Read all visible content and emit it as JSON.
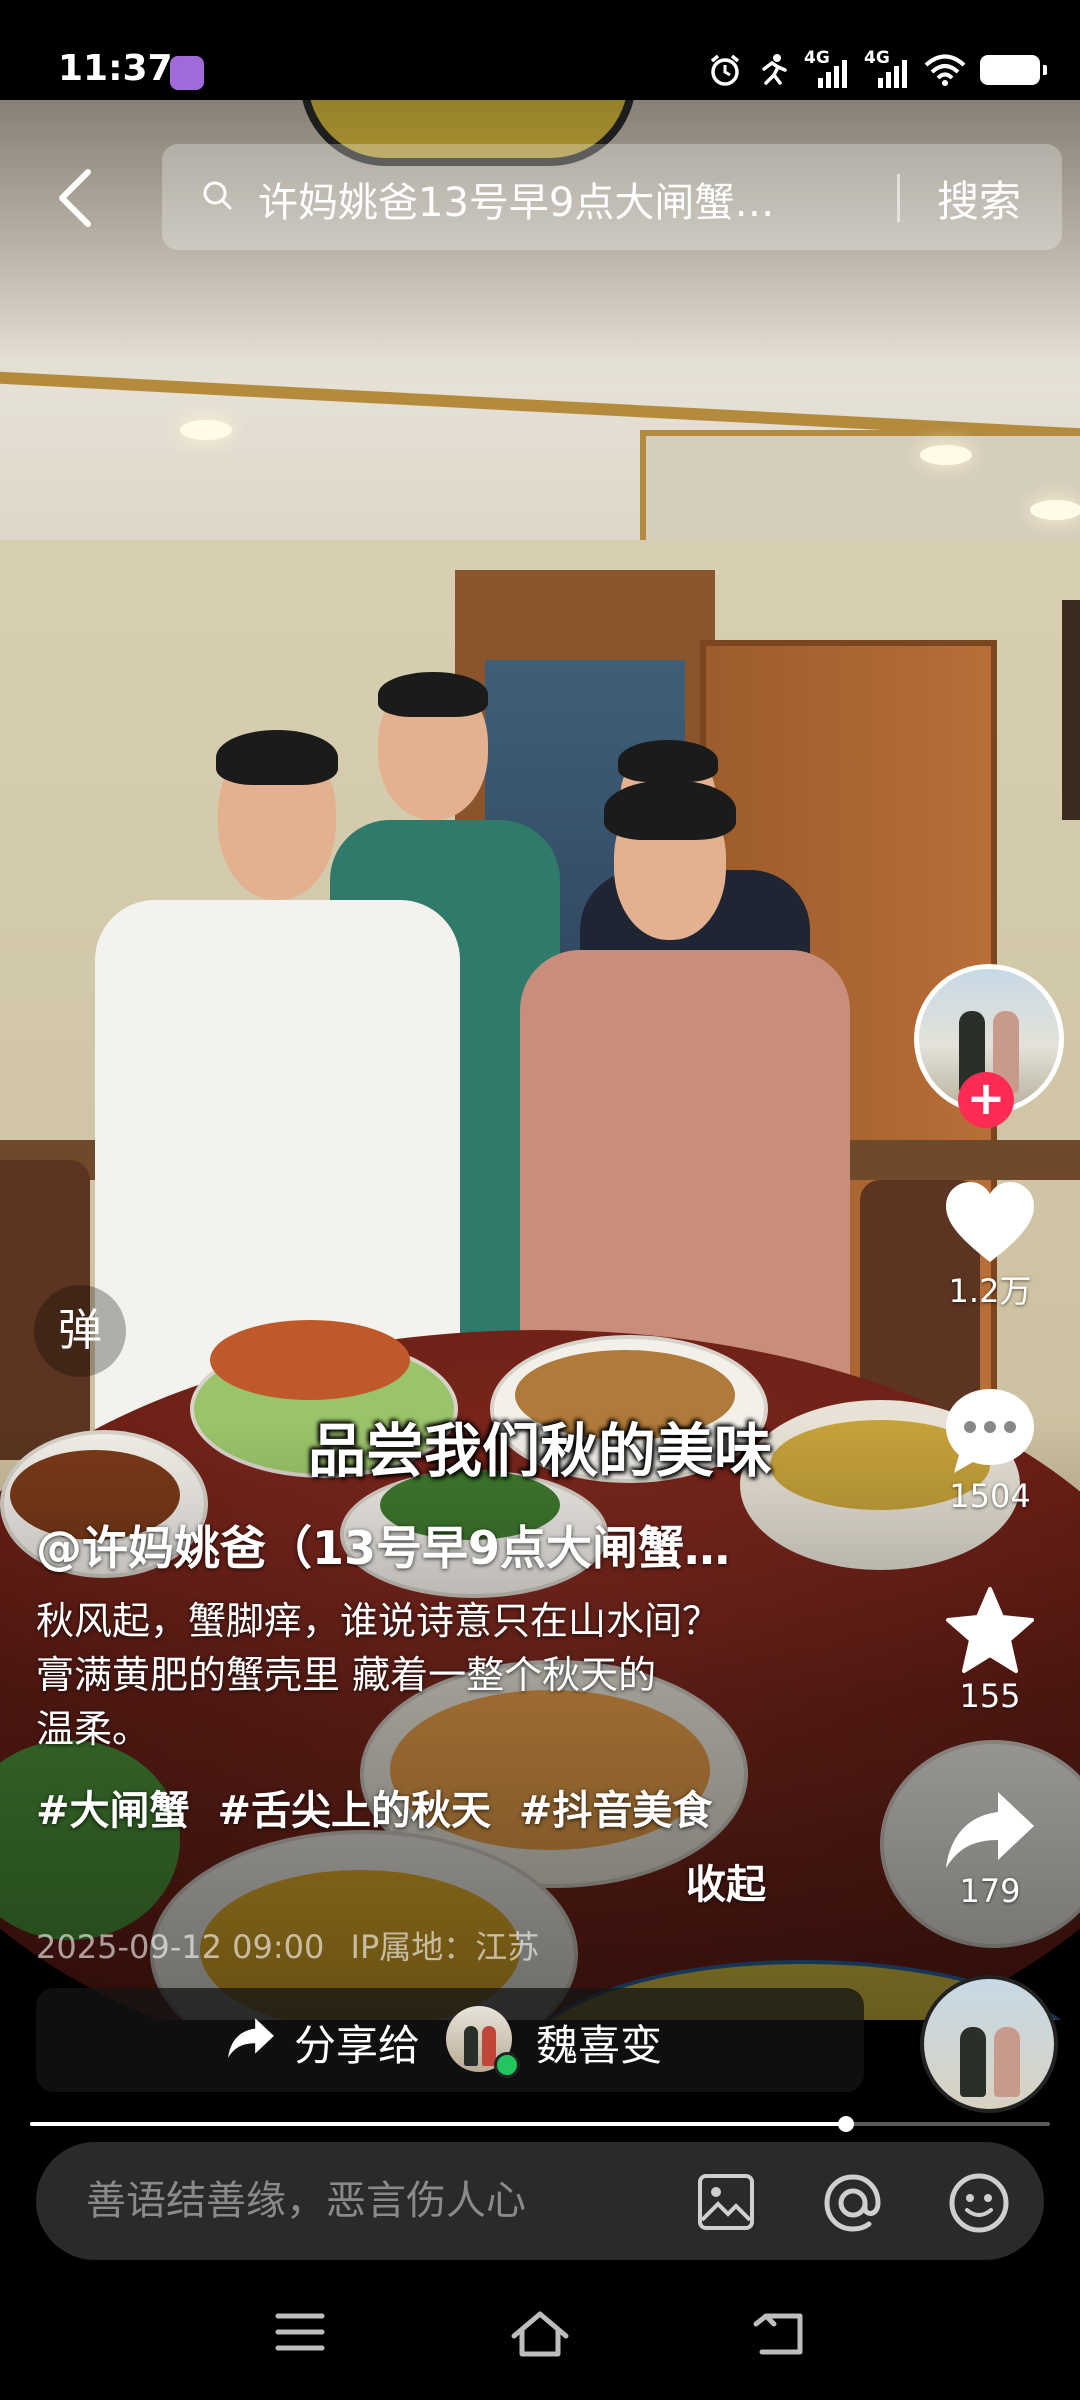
{
  "status_bar": {
    "time": "11:37",
    "network_1": "4G",
    "network_2": "4G",
    "icons": [
      "alarm-icon",
      "activity-icon",
      "signal-icon",
      "signal-icon",
      "wifi-icon",
      "battery-icon"
    ]
  },
  "search": {
    "query": "许妈姚爸13号早9点大闸蟹…",
    "button_label": "搜索"
  },
  "video": {
    "subtitle": "品尝我们秋的美味",
    "danmaku_label": "弹",
    "progress_fraction": 0.8
  },
  "actions": {
    "likes": "1.2万",
    "comments": "1504",
    "favorites": "155",
    "shares": "179",
    "follow_symbol": "+"
  },
  "post": {
    "author": "@许妈姚爸（13号早9点大闸蟹…",
    "description_lines": [
      "秋风起，蟹脚痒，谁说诗意只在山水间？",
      "膏满黄肥的蟹壳里 藏着一整个秋天的",
      "温柔。"
    ],
    "hashtags": [
      "#大闸蟹",
      "#舌尖上的秋天",
      "#抖音美食"
    ],
    "collapse_label": "收起",
    "date": "2025-09-12 09:00",
    "ip_location": "IP属地：江苏"
  },
  "share": {
    "label": "分享给",
    "friend_name": "魏喜变"
  },
  "comment_bar": {
    "placeholder": "善语结善缘，恶言伤人心"
  },
  "colors": {
    "accent_red": "#fe2c55",
    "online_green": "#22c55e"
  }
}
